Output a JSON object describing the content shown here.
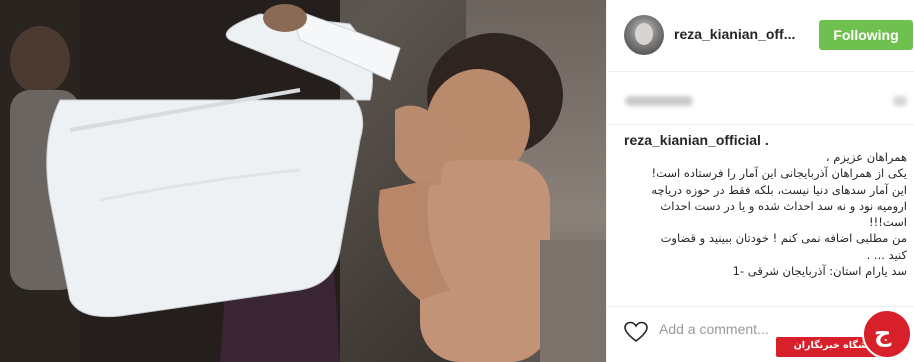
{
  "post": {
    "photo_alt": "",
    "header": {
      "username": "reza_kianian_off...",
      "follow_label": "Following",
      "follow_color": "#70c050"
    },
    "caption": {
      "username": "reza_kianian_official .",
      "lines": [
        "همراهان عزیزم ،",
        "یکی از همراهان آذربایجانی این آمار را فرستاده است!",
        "این آمار سدهای دنیا نیست، بلکه فقط در حوزه دریاچه",
        "ارومیه نود و نه سد احداث شده و یا در دست احداث",
        "است!!!",
        "من مطلبی اضافه نمی کنم ! خودتان ببینید و قضاوت",
        "کنید ... .",
        "سد یارام استان: آذربایجان شرقی -1"
      ]
    },
    "footer": {
      "heart_icon": "heart-outline-icon",
      "comment_placeholder": "Add a comment..."
    }
  },
  "watermark": {
    "text": "باشگاه خبرنگاران",
    "color": "#d8202a"
  }
}
